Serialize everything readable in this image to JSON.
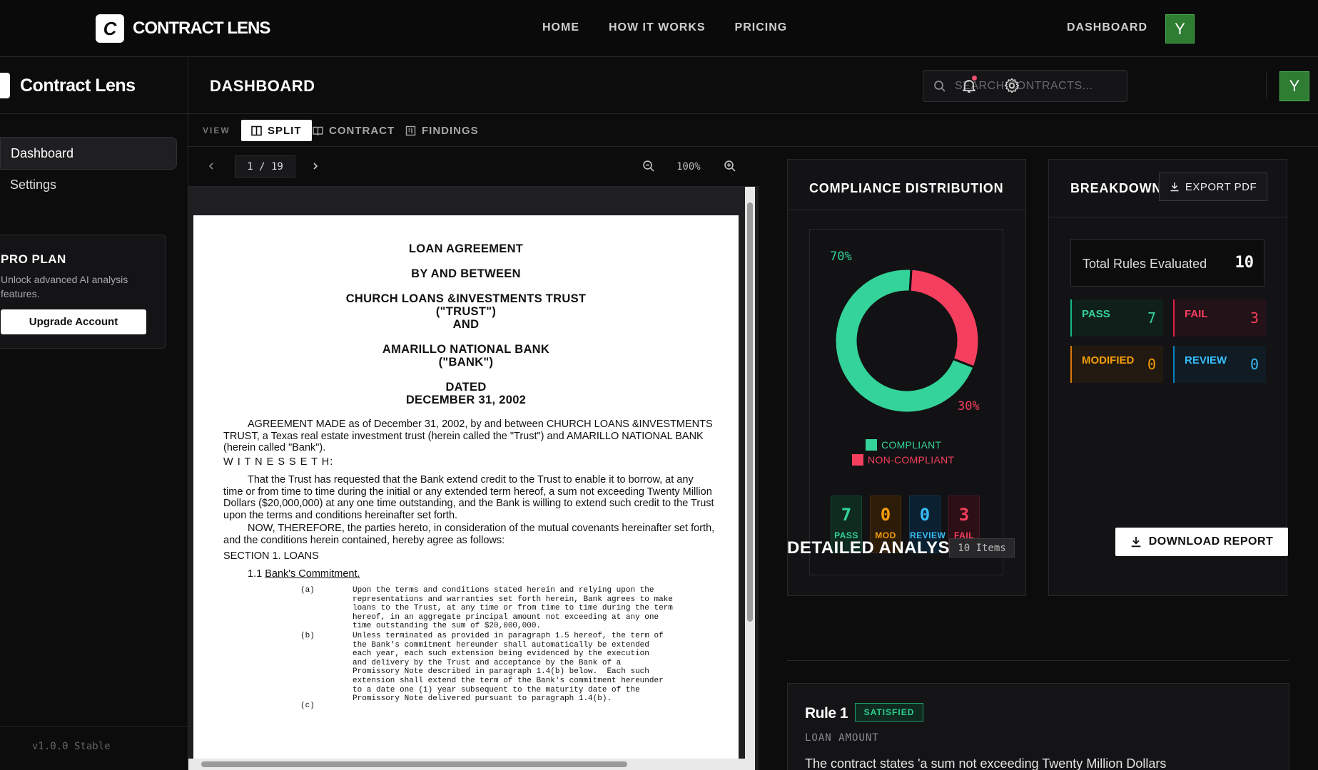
{
  "topnav": {
    "brand": "CONTRACT LENS",
    "brand_mark": "C",
    "links": [
      "HOME",
      "HOW IT WORKS",
      "PRICING"
    ],
    "dashboard": "DASHBOARD",
    "avatar": "Y"
  },
  "sidebar": {
    "brand": "Contract Lens",
    "items": [
      {
        "label": "Dashboard",
        "active": true
      },
      {
        "label": "Settings",
        "active": false
      }
    ],
    "pro": {
      "title": "PRO PLAN",
      "text": "Unlock advanced AI analysis features.",
      "button": "Upgrade Account"
    },
    "version": "v1.0.0 Stable"
  },
  "header": {
    "title": "DASHBOARD",
    "search_placeholder": "SEARCH CONTRACTS...",
    "avatar": "Y"
  },
  "viewbar": {
    "label": "VIEW",
    "options": [
      "SPLIT",
      "CONTRACT",
      "FINDINGS"
    ],
    "active": "SPLIT"
  },
  "viewer": {
    "page_current": "1",
    "page_sep": "/",
    "page_total": "19",
    "zoom": "100%"
  },
  "document": {
    "title1": "LOAN AGREEMENT",
    "title2": "BY AND BETWEEN",
    "party1_line1": "CHURCH LOANS &INVESTMENTS TRUST",
    "party1_line2": "(\"TRUST\")",
    "and": "AND",
    "party2_line1": "AMARILLO NATIONAL BANK",
    "party2_line2": "(\"BANK\")",
    "dated": "DATED",
    "date": "DECEMBER 31, 2002",
    "p1": "AGREEMENT MADE as of December 31, 2002, by and between CHURCH LOANS &INVESTMENTS TRUST, a Texas real estate investment trust (herein called the \"Trust\") and AMARILLO NATIONAL BANK (herein called \"Bank\").",
    "witnesseth": "W I T N E S S E T H:",
    "p2": "That the Trust has requested that the Bank extend credit to the Trust to enable it to borrow, at any time or from time to time during the initial or any extended term hereof, a sum not exceeding Twenty Million Dollars ($20,000,000) at any one time outstanding, and the Bank is willing to extend such credit to the Trust upon the terms and conditions hereinafter set forth.",
    "p3": "NOW, THEREFORE, the parties hereto, in consideration of the mutual covenants hereinafter set forth, and the conditions herein contained, hereby agree as follows:",
    "section1": "SECTION 1. LOANS",
    "s11_num": "1.1",
    "s11_title": "Bank's Commitment.",
    "a_label": "(a)",
    "a_text": "Upon the terms and conditions stated herein and relying upon the\nrepresentations and warranties set forth herein, Bank agrees to make\nloans to the Trust, at any time or from time to time during the term\nhereof, in an aggregate principal amount not exceeding at any one\ntime outstanding the sum of $20,000,000.",
    "b_label": "(b)",
    "b_text": "Unless terminated as provided in paragraph 1.5 hereof, the term of\nthe Bank's commitment hereunder shall automatically be extended\neach year, each such extension being evidenced by the execution\nand delivery by the Trust and acceptance by the Bank of a\nPromissory Note described in paragraph 1.4(b) below.  Each such\nextension shall extend the term of the Bank's commitment hereunder\nto a date one (1) year subsequent to the maturity date of the\nPromissory Note delivered pursuant to paragraph 1.4(b).",
    "c_label": "(c)"
  },
  "compliance": {
    "title": "COMPLIANCE DISTRIBUTION",
    "compliant_pct": "70%",
    "noncompliant_pct": "30%",
    "compliant_fraction": 0.7,
    "legend_compliant": "COMPLIANT",
    "legend_noncompliant": "NON-COMPLIANT",
    "minis": [
      {
        "value": "7",
        "label": "PASS"
      },
      {
        "value": "0",
        "label": "MOD"
      },
      {
        "value": "0",
        "label": "REVIEW"
      },
      {
        "value": "3",
        "label": "FAIL"
      }
    ],
    "colors": {
      "compliant": "#34d399",
      "noncompliant": "#f43f5e",
      "modified": "#f59e0b",
      "review": "#38bdf8"
    }
  },
  "breakdown": {
    "title": "BREAKDOWN",
    "export": "EXPORT PDF",
    "total_label": "Total Rules Evaluated",
    "total_value": "10",
    "stats": [
      {
        "label": "PASS",
        "value": "7"
      },
      {
        "label": "FAIL",
        "value": "3"
      },
      {
        "label": "MODIFIED",
        "value": "0"
      },
      {
        "label": "REVIEW",
        "value": "0"
      }
    ]
  },
  "analysis": {
    "title": "DETAILED ANALYSIS",
    "count": "10 Items",
    "download": "DOWNLOAD REPORT",
    "rules": [
      {
        "title": "Rule 1",
        "status": "SATISFIED",
        "subject": "LOAN AMOUNT",
        "text": "The contract states 'a sum not exceeding Twenty Million Dollars"
      }
    ]
  }
}
